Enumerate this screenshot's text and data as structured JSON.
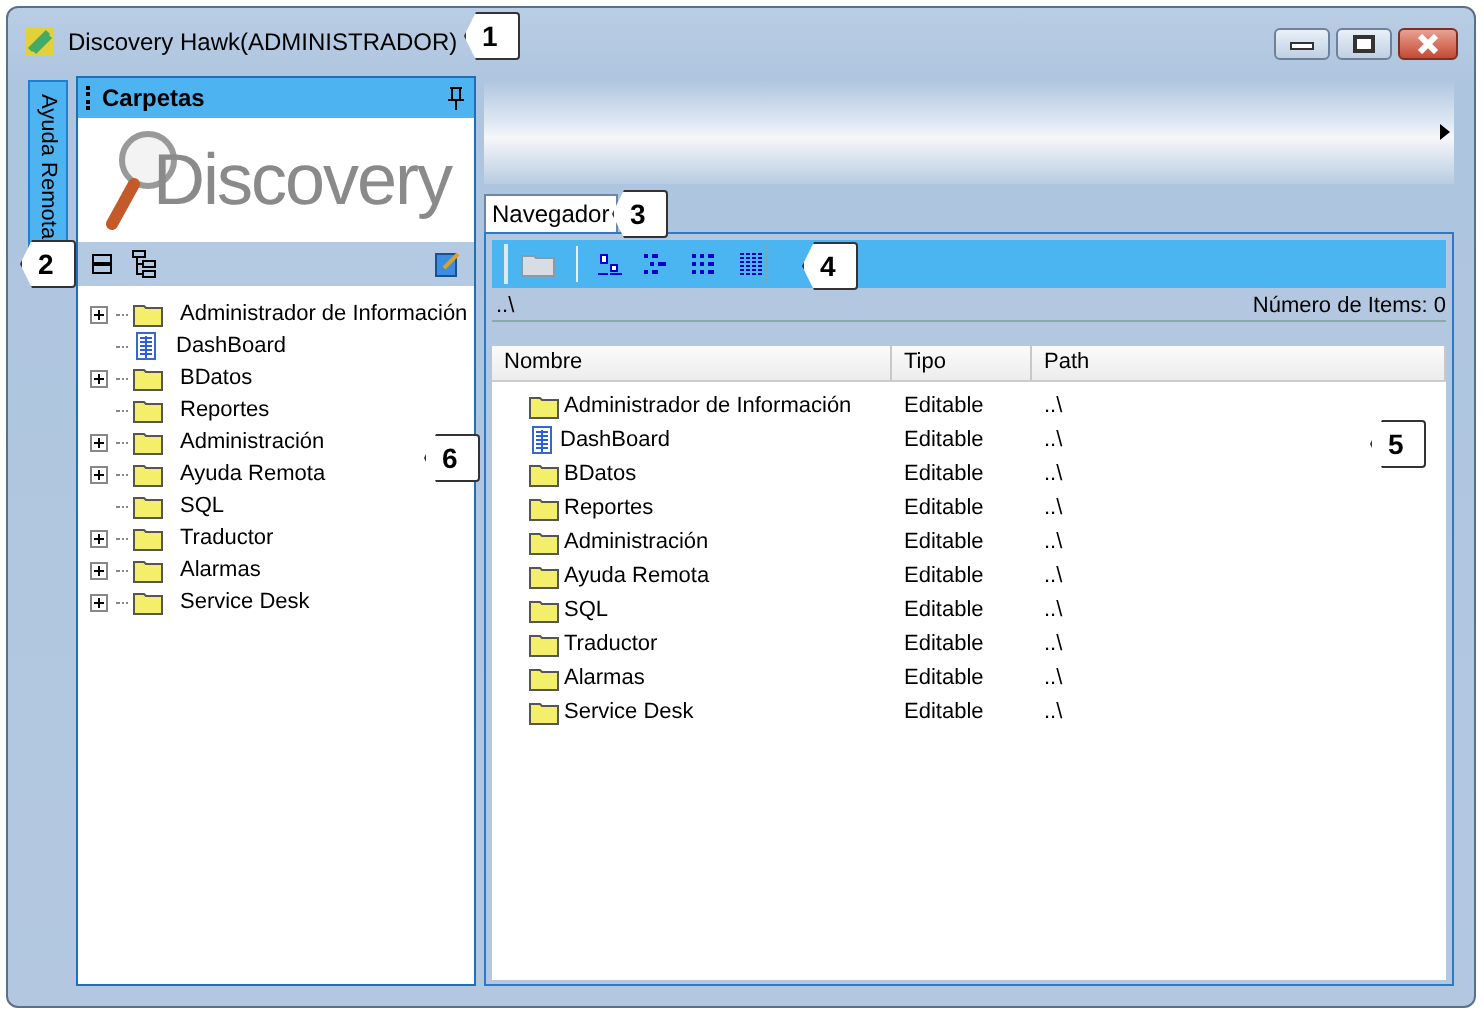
{
  "window": {
    "title": "Discovery Hawk(ADMINISTRADOR)"
  },
  "side_tab": {
    "label": "Ayuda Remota",
    "selected": true
  },
  "folders_panel": {
    "title": "Carpetas",
    "logo": "Discovery",
    "tree": [
      {
        "label": "Administrador de Información",
        "kind": "folder",
        "expandable": true
      },
      {
        "label": "DashBoard",
        "kind": "document",
        "expandable": false
      },
      {
        "label": "BDatos",
        "kind": "folder",
        "expandable": true
      },
      {
        "label": "Reportes",
        "kind": "folder",
        "expandable": false
      },
      {
        "label": "Administración",
        "kind": "folder",
        "expandable": true
      },
      {
        "label": "Ayuda Remota",
        "kind": "folder",
        "expandable": true
      },
      {
        "label": "SQL",
        "kind": "folder",
        "expandable": false
      },
      {
        "label": "Traductor",
        "kind": "folder",
        "expandable": true
      },
      {
        "label": "Alarmas",
        "kind": "folder",
        "expandable": true
      },
      {
        "label": "Service Desk",
        "kind": "folder",
        "expandable": true
      }
    ]
  },
  "tabs": [
    {
      "label": "Navegador",
      "selected": true
    }
  ],
  "path": "..\\",
  "item_count": "Número de Items: 0",
  "table": {
    "columns": [
      "Nombre",
      "Tipo",
      "Path"
    ],
    "rows": [
      {
        "kind": "folder",
        "name": "Administrador de Información",
        "tipo": "Editable",
        "path": "..\\"
      },
      {
        "kind": "document",
        "name": "DashBoard",
        "tipo": "Editable",
        "path": "..\\"
      },
      {
        "kind": "folder",
        "name": "BDatos",
        "tipo": "Editable",
        "path": "..\\"
      },
      {
        "kind": "folder",
        "name": "Reportes",
        "tipo": "Editable",
        "path": "..\\"
      },
      {
        "kind": "folder",
        "name": "Administración",
        "tipo": "Editable",
        "path": "..\\"
      },
      {
        "kind": "folder",
        "name": "Ayuda Remota",
        "tipo": "Editable",
        "path": "..\\"
      },
      {
        "kind": "folder",
        "name": "SQL",
        "tipo": "Editable",
        "path": "..\\"
      },
      {
        "kind": "folder",
        "name": "Traductor",
        "tipo": "Editable",
        "path": "..\\"
      },
      {
        "kind": "folder",
        "name": "Alarmas",
        "tipo": "Editable",
        "path": "..\\"
      },
      {
        "kind": "folder",
        "name": "Service Desk",
        "tipo": "Editable",
        "path": "..\\"
      }
    ]
  },
  "callouts": [
    {
      "label": "1"
    },
    {
      "label": "2"
    },
    {
      "label": "3"
    },
    {
      "label": "4"
    },
    {
      "label": "5"
    },
    {
      "label": "6"
    }
  ]
}
